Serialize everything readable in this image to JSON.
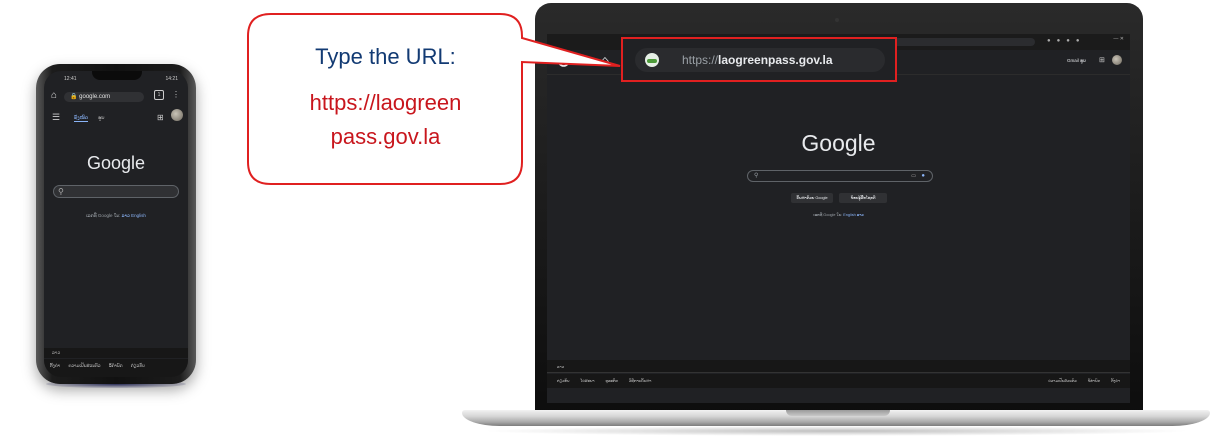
{
  "callout": {
    "line1": "Type the URL:",
    "line2": "https://laogreen",
    "line3": "pass.gov.la",
    "border_color": "#e02020",
    "text_primary_color": "#123a73",
    "text_accent_color": "#c8161d"
  },
  "address_bar": {
    "protocol": "https://",
    "domain": "laogreenpass.gov.la",
    "site_icon": "laogreenpass-favicon"
  },
  "phone": {
    "status_left": "12:41",
    "status_right": "14:21",
    "url": "google.com",
    "tabs_count": "1",
    "nav_tabs": [
      "ທັງໝົດ",
      "ຮູບ"
    ],
    "logo": "Google",
    "offered_in_prefix": "ເລກທີ Google ໃນ:",
    "offered_in_lang1": "ລາວ",
    "offered_in_lang2": "English",
    "footer_top": "ລາວ",
    "footer_links": [
      "ຕັ້ງຄ່າ",
      "ຄວາມເປັນສ່ວນຕົວ",
      "ຂໍ້ກຳນົດ",
      "ກ່ຽວກັບ"
    ]
  },
  "laptop": {
    "header_links": "Gmail  ຮູບ",
    "logo": "Google",
    "search_button": "ຄົ້ນຫາດ້ວຍ Google",
    "lucky_button": "ຂ້ອຍຮູ້ສຶກໂຊກດີ",
    "offered_in_prefix": "ເລກທີ Google ໃນ:",
    "offered_in_lang1": "English",
    "offered_in_lang2": "ລາວ",
    "footer_top": "ລາວ",
    "footer_left": [
      "ກ່ຽວກັບ",
      "ໂຄສະນາ",
      "ທຸລະກິດ",
      "ວິທີການຄົ້ນຫາ"
    ],
    "footer_right": [
      "ຄວາມເປັນສ່ວນຕົວ",
      "ຂໍ້ກຳນົດ",
      "ຕັ້ງຄ່າ"
    ]
  }
}
